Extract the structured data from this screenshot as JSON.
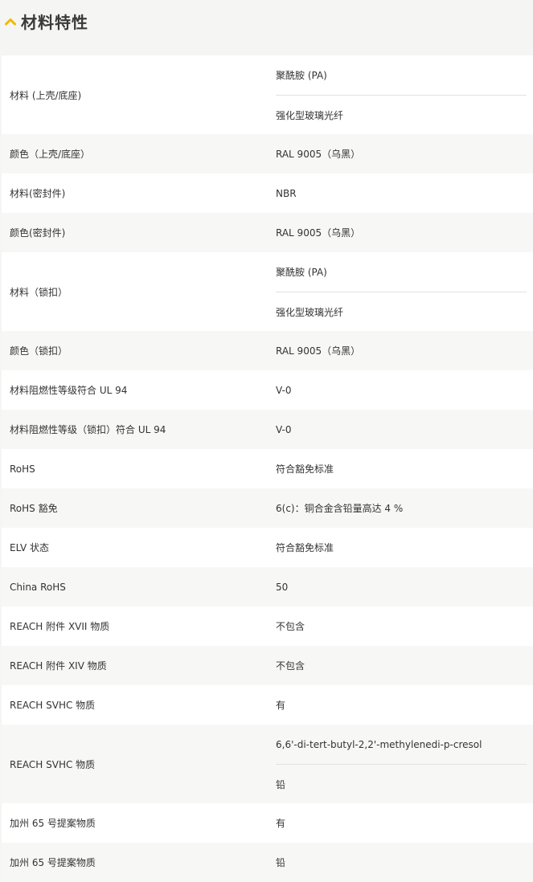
{
  "section": {
    "title": "材料特性",
    "icon": "chevron-up-icon",
    "accent_color": "#f2b705"
  },
  "rows": [
    {
      "label": "材料 (上壳/底座)",
      "values": [
        "聚酰胺 (PA)",
        "强化型玻璃光纤"
      ]
    },
    {
      "label": "颜色（上壳/底座）",
      "values": [
        "RAL 9005（乌黑）"
      ]
    },
    {
      "label": "材料(密封件)",
      "values": [
        "NBR"
      ]
    },
    {
      "label": "颜色(密封件)",
      "values": [
        "RAL 9005（乌黑）"
      ]
    },
    {
      "label": "材料（锁扣）",
      "values": [
        "聚酰胺 (PA)",
        "强化型玻璃光纤"
      ]
    },
    {
      "label": "颜色（锁扣）",
      "values": [
        "RAL 9005（乌黑）"
      ]
    },
    {
      "label": "材料阻燃性等级符合 UL 94",
      "values": [
        "V-0"
      ]
    },
    {
      "label": "材料阻燃性等级（锁扣）符合 UL 94",
      "values": [
        "V-0"
      ]
    },
    {
      "label": "RoHS",
      "values": [
        "符合豁免标准"
      ]
    },
    {
      "label": "RoHS 豁免",
      "values": [
        "6(c)：铜合金含铅量高达 4 %"
      ]
    },
    {
      "label": "ELV 状态",
      "values": [
        "符合豁免标准"
      ]
    },
    {
      "label": "China RoHS",
      "values": [
        "50"
      ]
    },
    {
      "label": "REACH 附件 XVII 物质",
      "values": [
        "不包含"
      ]
    },
    {
      "label": "REACH 附件 XIV 物质",
      "values": [
        "不包含"
      ]
    },
    {
      "label": "REACH SVHC 物质",
      "values": [
        "有"
      ]
    },
    {
      "label": "REACH SVHC 物质",
      "values": [
        "6,6'-di-tert-butyl-2,2'-methylenedi-p-cresol",
        "铅"
      ]
    },
    {
      "label": "加州 65 号提案物质",
      "values": [
        "有"
      ]
    },
    {
      "label": "加州 65 号提案物质",
      "values": [
        "铅"
      ]
    }
  ]
}
